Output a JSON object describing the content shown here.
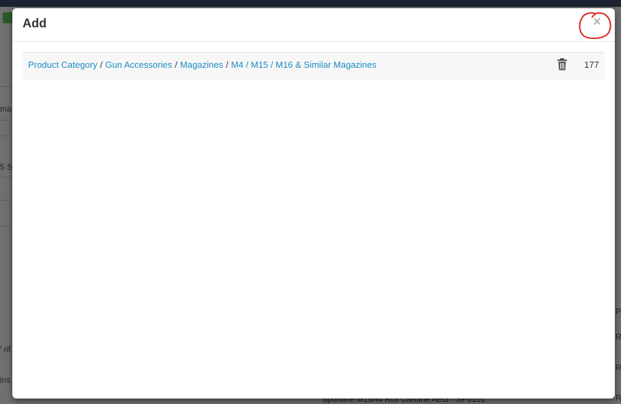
{
  "modal": {
    "title": "Add",
    "close_label": "×",
    "row": {
      "breadcrumb": [
        "Product Category",
        "Gun Accessories",
        "Magazines",
        "M4 / M15 / M16 & Similar Magazines"
      ],
      "separator": "/",
      "id": "177"
    }
  },
  "background": {
    "fragments": [
      "ma",
      "5 S",
      "' rif",
      "ins",
      "P",
      "R",
      "R",
      "R",
      "R"
    ],
    "bottom_row": "Sportline M15A4 RIS Carbine AEG - SP0101"
  },
  "colors": {
    "link": "#1a8cc4",
    "annotation": "#d9241c"
  }
}
